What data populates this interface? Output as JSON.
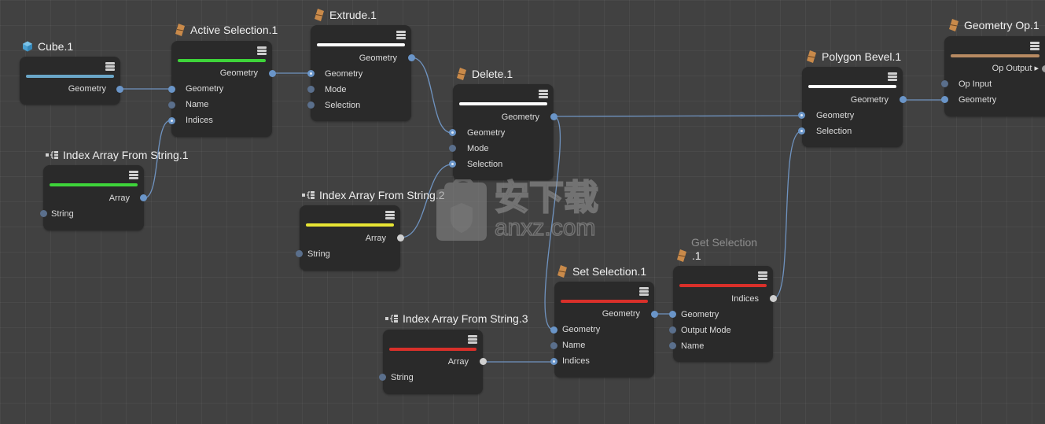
{
  "colors": {
    "background": "#414141",
    "node_bg": "#2a2a2a",
    "wire": "#6f93c0",
    "port_connected": "#6a95c8",
    "port_output_gray": "#cfcfcf",
    "bar_blue": "#6aa6c8",
    "bar_green": "#3ed43a",
    "bar_white": "#ffffff",
    "bar_yellow": "#e8e534",
    "bar_red": "#d9302a",
    "bar_brown": "#b78a62",
    "op_icon": "#c98a4a"
  },
  "nodes": {
    "cube": {
      "title": "Cube.1",
      "icon": "cube-icon",
      "outputs": [
        "Geometry"
      ],
      "inputs": []
    },
    "active_selection": {
      "title": "Active Selection.1",
      "icon": "operator-icon",
      "outputs": [
        "Geometry"
      ],
      "inputs": [
        "Geometry",
        "Name",
        "Indices"
      ]
    },
    "extrude": {
      "title": "Extrude.1",
      "icon": "operator-icon",
      "outputs": [
        "Geometry"
      ],
      "inputs": [
        "Geometry",
        "Mode",
        "Selection"
      ]
    },
    "delete": {
      "title": "Delete.1",
      "icon": "operator-icon",
      "outputs": [
        "Geometry"
      ],
      "inputs": [
        "Geometry",
        "Mode",
        "Selection"
      ]
    },
    "polygon_bevel": {
      "title": "Polygon Bevel.1",
      "icon": "operator-icon",
      "outputs": [
        "Geometry"
      ],
      "inputs": [
        "Geometry",
        "Selection"
      ]
    },
    "geometry_op": {
      "title": "Geometry Op.1",
      "icon": "operator-icon",
      "outputs": [
        "Op Output ▸"
      ],
      "inputs": [
        "Op Input",
        "Geometry"
      ]
    },
    "index_array_1": {
      "title": "Index Array From String.1",
      "icon": "array-icon",
      "outputs": [
        "Array"
      ],
      "inputs": [
        "String"
      ]
    },
    "index_array_2": {
      "title": "Index Array From String.2",
      "icon": "array-icon",
      "outputs": [
        "Array"
      ],
      "inputs": [
        "String"
      ]
    },
    "index_array_3": {
      "title": "Index Array From String.3",
      "icon": "array-icon",
      "outputs": [
        "Array"
      ],
      "inputs": [
        "String"
      ]
    },
    "set_selection": {
      "title": "Set Selection.1",
      "icon": "operator-icon",
      "outputs": [
        "Geometry"
      ],
      "inputs": [
        "Geometry",
        "Name",
        "Indices"
      ]
    },
    "get_selection": {
      "title_top": "Get Selection",
      "title": ".1",
      "icon": "operator-icon",
      "outputs": [
        "Indices"
      ],
      "inputs": [
        "Geometry",
        "Output Mode",
        "Name"
      ]
    }
  },
  "watermark": {
    "brand": "安下载",
    "site": "anxz.com"
  }
}
